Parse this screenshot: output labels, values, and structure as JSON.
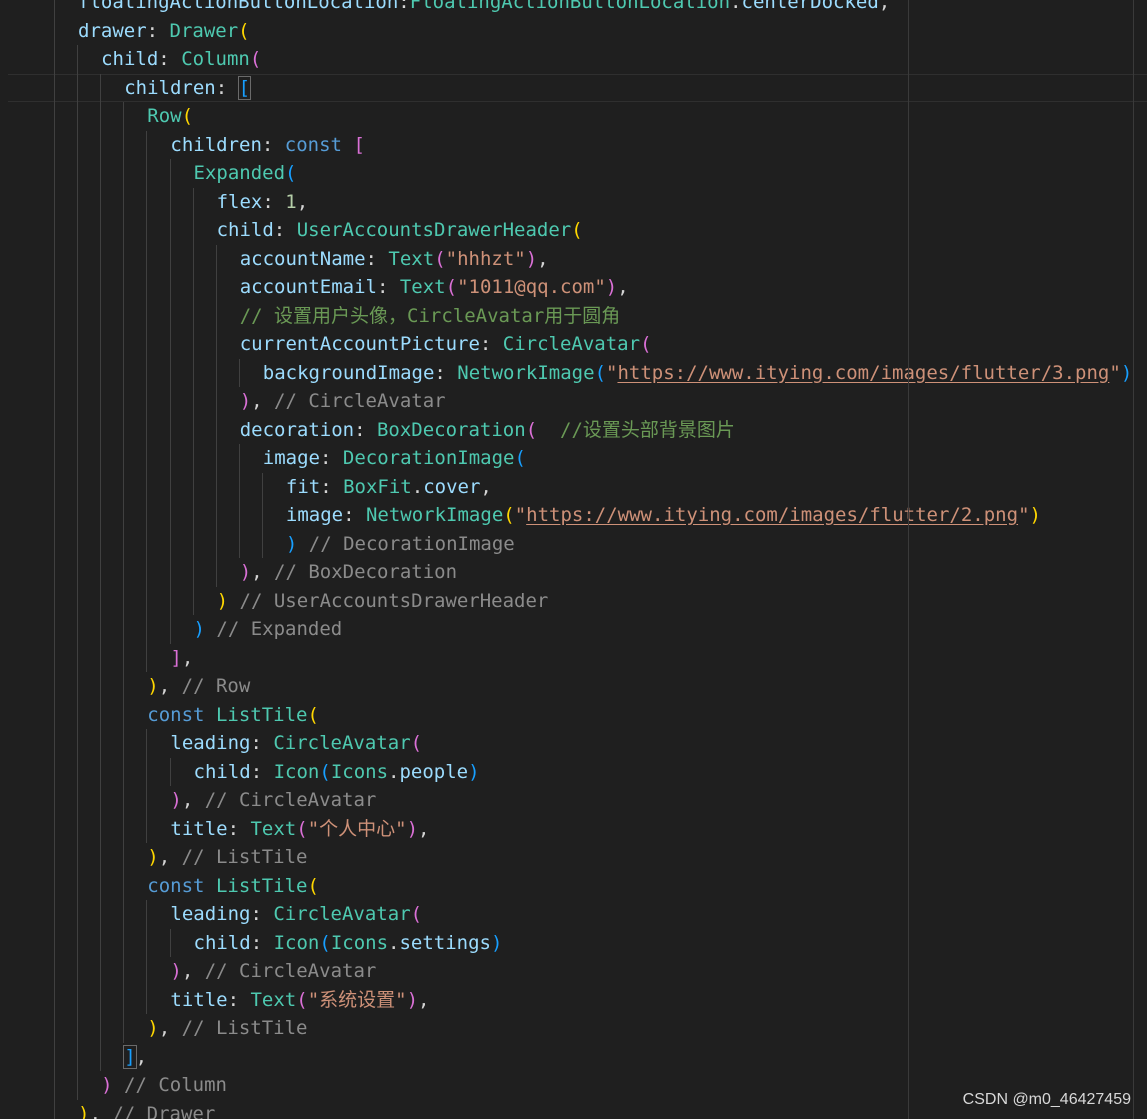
{
  "editor": {
    "language": "dart",
    "colors": {
      "background": "#1f1f1f",
      "property": "#9cdcfe",
      "class": "#4ec9b0",
      "keyword": "#569cd6",
      "string": "#ce9178",
      "number": "#b5cea8",
      "comment_gray": "#8b8b8b",
      "comment_green": "#6a9955",
      "bracket_gold": "#ffd700",
      "bracket_pink": "#da70d6",
      "bracket_blue": "#179fff",
      "punctuation": "#d4d4d4"
    },
    "lines": [
      {
        "indent": 0,
        "guides": 3,
        "tokens": [
          {
            "t": "floatingActionButtonLocation",
            "c": "p"
          },
          {
            "t": ":",
            "c": "x"
          },
          {
            "t": "FloatingActionButtonLocation",
            "c": "t"
          },
          {
            "t": ".",
            "c": "x"
          },
          {
            "t": "centerDocked",
            "c": "p"
          },
          {
            "t": ",",
            "c": "x"
          }
        ]
      },
      {
        "indent": 0,
        "guides": 3,
        "tokens": [
          {
            "t": "drawer",
            "c": "p"
          },
          {
            "t": ": ",
            "c": "x"
          },
          {
            "t": "Drawer",
            "c": "t"
          },
          {
            "t": "(",
            "c": "y"
          }
        ]
      },
      {
        "indent": 1,
        "guides": 4,
        "tokens": [
          {
            "t": "child",
            "c": "p"
          },
          {
            "t": ": ",
            "c": "x"
          },
          {
            "t": "Column",
            "c": "t"
          },
          {
            "t": "(",
            "c": "m"
          }
        ]
      },
      {
        "indent": 2,
        "guides": 5,
        "current": true,
        "tokens": [
          {
            "t": "children",
            "c": "p"
          },
          {
            "t": ": ",
            "c": "x"
          },
          {
            "t": "[",
            "c": "b",
            "box": true
          }
        ]
      },
      {
        "indent": 3,
        "guides": 6,
        "tokens": [
          {
            "t": "Row",
            "c": "t"
          },
          {
            "t": "(",
            "c": "y"
          }
        ]
      },
      {
        "indent": 4,
        "guides": 7,
        "tokens": [
          {
            "t": "children",
            "c": "p"
          },
          {
            "t": ": ",
            "c": "x"
          },
          {
            "t": "const",
            "c": "k"
          },
          {
            "t": " ",
            "c": "x"
          },
          {
            "t": "[",
            "c": "m"
          }
        ]
      },
      {
        "indent": 5,
        "guides": 8,
        "tokens": [
          {
            "t": "Expanded",
            "c": "t"
          },
          {
            "t": "(",
            "c": "b"
          }
        ]
      },
      {
        "indent": 6,
        "guides": 9,
        "tokens": [
          {
            "t": "flex",
            "c": "p"
          },
          {
            "t": ": ",
            "c": "x"
          },
          {
            "t": "1",
            "c": "n"
          },
          {
            "t": ",",
            "c": "x"
          }
        ]
      },
      {
        "indent": 6,
        "guides": 9,
        "tokens": [
          {
            "t": "child",
            "c": "p"
          },
          {
            "t": ": ",
            "c": "x"
          },
          {
            "t": "UserAccountsDrawerHeader",
            "c": "t"
          },
          {
            "t": "(",
            "c": "y"
          }
        ]
      },
      {
        "indent": 7,
        "guides": 10,
        "tokens": [
          {
            "t": "accountName",
            "c": "p"
          },
          {
            "t": ": ",
            "c": "x"
          },
          {
            "t": "Text",
            "c": "t"
          },
          {
            "t": "(",
            "c": "m"
          },
          {
            "t": "\"hhhzt\"",
            "c": "s"
          },
          {
            "t": ")",
            "c": "m"
          },
          {
            "t": ",",
            "c": "x"
          }
        ]
      },
      {
        "indent": 7,
        "guides": 10,
        "tokens": [
          {
            "t": "accountEmail",
            "c": "p"
          },
          {
            "t": ": ",
            "c": "x"
          },
          {
            "t": "Text",
            "c": "t"
          },
          {
            "t": "(",
            "c": "m"
          },
          {
            "t": "\"1011@qq.com\"",
            "c": "s"
          },
          {
            "t": ")",
            "c": "m"
          },
          {
            "t": ",",
            "c": "x"
          }
        ]
      },
      {
        "indent": 7,
        "guides": 10,
        "tokens": [
          {
            "t": "// 设置用户头像，CircleAvatar用于圆角",
            "c": "g"
          }
        ]
      },
      {
        "indent": 7,
        "guides": 10,
        "tokens": [
          {
            "t": "currentAccountPicture",
            "c": "p"
          },
          {
            "t": ": ",
            "c": "x"
          },
          {
            "t": "CircleAvatar",
            "c": "t"
          },
          {
            "t": "(",
            "c": "m"
          }
        ]
      },
      {
        "indent": 8,
        "guides": 11,
        "tokens": [
          {
            "t": "backgroundImage",
            "c": "p"
          },
          {
            "t": ": ",
            "c": "x"
          },
          {
            "t": "NetworkImage",
            "c": "t"
          },
          {
            "t": "(",
            "c": "b"
          },
          {
            "t": "\"",
            "c": "s"
          },
          {
            "t": "https://www.itying.com/images/flutter/3.png",
            "c": "s",
            "u": true
          },
          {
            "t": "\"",
            "c": "s"
          },
          {
            "t": ")",
            "c": "b"
          }
        ]
      },
      {
        "indent": 7,
        "guides": 10,
        "tokens": [
          {
            "t": ")",
            "c": "m"
          },
          {
            "t": ", ",
            "c": "x"
          },
          {
            "t": "// CircleAvatar",
            "c": "c"
          }
        ]
      },
      {
        "indent": 7,
        "guides": 10,
        "tokens": [
          {
            "t": "decoration",
            "c": "p"
          },
          {
            "t": ": ",
            "c": "x"
          },
          {
            "t": "BoxDecoration",
            "c": "t"
          },
          {
            "t": "(",
            "c": "m"
          },
          {
            "t": "  ",
            "c": "x"
          },
          {
            "t": "//设置头部背景图片",
            "c": "g"
          }
        ]
      },
      {
        "indent": 8,
        "guides": 11,
        "tokens": [
          {
            "t": "image",
            "c": "p"
          },
          {
            "t": ": ",
            "c": "x"
          },
          {
            "t": "DecorationImage",
            "c": "t"
          },
          {
            "t": "(",
            "c": "b"
          }
        ]
      },
      {
        "indent": 9,
        "guides": 12,
        "tokens": [
          {
            "t": "fit",
            "c": "p"
          },
          {
            "t": ": ",
            "c": "x"
          },
          {
            "t": "BoxFit",
            "c": "t"
          },
          {
            "t": ".",
            "c": "x"
          },
          {
            "t": "cover",
            "c": "p"
          },
          {
            "t": ",",
            "c": "x"
          }
        ]
      },
      {
        "indent": 9,
        "guides": 12,
        "tokens": [
          {
            "t": "image",
            "c": "p"
          },
          {
            "t": ": ",
            "c": "x"
          },
          {
            "t": "NetworkImage",
            "c": "t"
          },
          {
            "t": "(",
            "c": "y"
          },
          {
            "t": "\"",
            "c": "s"
          },
          {
            "t": "https://www.itying.com/images/flutter/2.png",
            "c": "s",
            "u": true
          },
          {
            "t": "\"",
            "c": "s"
          },
          {
            "t": ")",
            "c": "y"
          }
        ]
      },
      {
        "indent": 9,
        "guides": 12,
        "tokens": [
          {
            "t": ")",
            "c": "b"
          },
          {
            "t": " ",
            "c": "x"
          },
          {
            "t": "// DecorationImage",
            "c": "c"
          }
        ]
      },
      {
        "indent": 7,
        "guides": 10,
        "tokens": [
          {
            "t": ")",
            "c": "m"
          },
          {
            "t": ", ",
            "c": "x"
          },
          {
            "t": "// BoxDecoration",
            "c": "c"
          }
        ]
      },
      {
        "indent": 6,
        "guides": 9,
        "tokens": [
          {
            "t": ")",
            "c": "y"
          },
          {
            "t": " ",
            "c": "x"
          },
          {
            "t": "// UserAccountsDrawerHeader",
            "c": "c"
          }
        ]
      },
      {
        "indent": 5,
        "guides": 8,
        "tokens": [
          {
            "t": ")",
            "c": "b"
          },
          {
            "t": " ",
            "c": "x"
          },
          {
            "t": "// Expanded",
            "c": "c"
          }
        ]
      },
      {
        "indent": 4,
        "guides": 7,
        "tokens": [
          {
            "t": "]",
            "c": "m"
          },
          {
            "t": ",",
            "c": "x"
          }
        ]
      },
      {
        "indent": 3,
        "guides": 6,
        "tokens": [
          {
            "t": ")",
            "c": "y"
          },
          {
            "t": ", ",
            "c": "x"
          },
          {
            "t": "// Row",
            "c": "c"
          }
        ]
      },
      {
        "indent": 3,
        "guides": 6,
        "tokens": [
          {
            "t": "const",
            "c": "k"
          },
          {
            "t": " ",
            "c": "x"
          },
          {
            "t": "ListTile",
            "c": "t"
          },
          {
            "t": "(",
            "c": "y"
          }
        ]
      },
      {
        "indent": 4,
        "guides": 7,
        "tokens": [
          {
            "t": "leading",
            "c": "p"
          },
          {
            "t": ": ",
            "c": "x"
          },
          {
            "t": "CircleAvatar",
            "c": "t"
          },
          {
            "t": "(",
            "c": "m"
          }
        ]
      },
      {
        "indent": 5,
        "guides": 8,
        "tokens": [
          {
            "t": "child",
            "c": "p"
          },
          {
            "t": ": ",
            "c": "x"
          },
          {
            "t": "Icon",
            "c": "t"
          },
          {
            "t": "(",
            "c": "b"
          },
          {
            "t": "Icons",
            "c": "t"
          },
          {
            "t": ".",
            "c": "x"
          },
          {
            "t": "people",
            "c": "p"
          },
          {
            "t": ")",
            "c": "b"
          }
        ]
      },
      {
        "indent": 4,
        "guides": 7,
        "tokens": [
          {
            "t": ")",
            "c": "m"
          },
          {
            "t": ", ",
            "c": "x"
          },
          {
            "t": "// CircleAvatar",
            "c": "c"
          }
        ]
      },
      {
        "indent": 4,
        "guides": 7,
        "tokens": [
          {
            "t": "title",
            "c": "p"
          },
          {
            "t": ": ",
            "c": "x"
          },
          {
            "t": "Text",
            "c": "t"
          },
          {
            "t": "(",
            "c": "m"
          },
          {
            "t": "\"个人中心\"",
            "c": "s"
          },
          {
            "t": ")",
            "c": "m"
          },
          {
            "t": ",",
            "c": "x"
          }
        ]
      },
      {
        "indent": 3,
        "guides": 6,
        "tokens": [
          {
            "t": ")",
            "c": "y"
          },
          {
            "t": ", ",
            "c": "x"
          },
          {
            "t": "// ListTile",
            "c": "c"
          }
        ]
      },
      {
        "indent": 3,
        "guides": 6,
        "tokens": [
          {
            "t": "const",
            "c": "k"
          },
          {
            "t": " ",
            "c": "x"
          },
          {
            "t": "ListTile",
            "c": "t"
          },
          {
            "t": "(",
            "c": "y"
          }
        ]
      },
      {
        "indent": 4,
        "guides": 7,
        "tokens": [
          {
            "t": "leading",
            "c": "p"
          },
          {
            "t": ": ",
            "c": "x"
          },
          {
            "t": "CircleAvatar",
            "c": "t"
          },
          {
            "t": "(",
            "c": "m"
          }
        ]
      },
      {
        "indent": 5,
        "guides": 8,
        "tokens": [
          {
            "t": "child",
            "c": "p"
          },
          {
            "t": ": ",
            "c": "x"
          },
          {
            "t": "Icon",
            "c": "t"
          },
          {
            "t": "(",
            "c": "b"
          },
          {
            "t": "Icons",
            "c": "t"
          },
          {
            "t": ".",
            "c": "x"
          },
          {
            "t": "settings",
            "c": "p"
          },
          {
            "t": ")",
            "c": "b"
          }
        ]
      },
      {
        "indent": 4,
        "guides": 7,
        "tokens": [
          {
            "t": ")",
            "c": "m"
          },
          {
            "t": ", ",
            "c": "x"
          },
          {
            "t": "// CircleAvatar",
            "c": "c"
          }
        ]
      },
      {
        "indent": 4,
        "guides": 7,
        "tokens": [
          {
            "t": "title",
            "c": "p"
          },
          {
            "t": ": ",
            "c": "x"
          },
          {
            "t": "Text",
            "c": "t"
          },
          {
            "t": "(",
            "c": "m"
          },
          {
            "t": "\"系统设置\"",
            "c": "s"
          },
          {
            "t": ")",
            "c": "m"
          },
          {
            "t": ",",
            "c": "x"
          }
        ]
      },
      {
        "indent": 3,
        "guides": 6,
        "tokens": [
          {
            "t": ")",
            "c": "y"
          },
          {
            "t": ", ",
            "c": "x"
          },
          {
            "t": "// ListTile",
            "c": "c"
          }
        ]
      },
      {
        "indent": 2,
        "guides": 5,
        "tokens": [
          {
            "t": "]",
            "c": "b",
            "box": true
          },
          {
            "t": ",",
            "c": "x"
          }
        ]
      },
      {
        "indent": 1,
        "guides": 4,
        "tokens": [
          {
            "t": ")",
            "c": "m"
          },
          {
            "t": " ",
            "c": "x"
          },
          {
            "t": "// Column",
            "c": "c"
          }
        ]
      },
      {
        "indent": 0,
        "guides": 3,
        "tokens": [
          {
            "t": ")",
            "c": "y"
          },
          {
            "t": ", ",
            "c": "x"
          },
          {
            "t": "// Drawer",
            "c": "c"
          }
        ]
      }
    ]
  },
  "watermark": {
    "text": "CSDN @m0_46427459"
  }
}
